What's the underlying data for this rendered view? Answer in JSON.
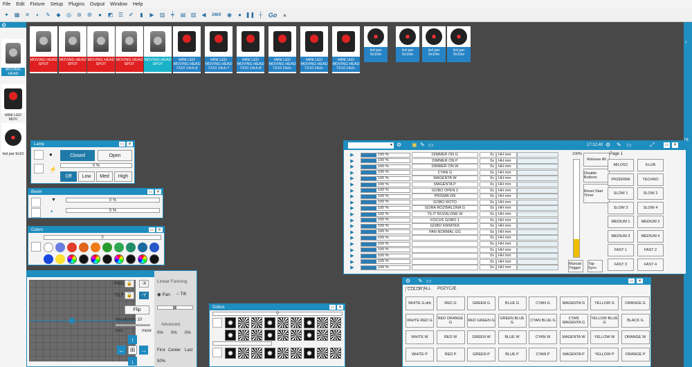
{
  "menu": [
    "File",
    "Edit",
    "Fixture",
    "Setup",
    "Plugins",
    "Output",
    "Window",
    "Help"
  ],
  "toolbar": {
    "dmx": "DMX",
    "go": "Go"
  },
  "left_fixtures": [
    "MOVING HEAD",
    "MINI LED MOV",
    "led par 9x10"
  ],
  "fixtures": [
    {
      "label": "MOVING HEAD SPOT",
      "style": "red",
      "kind": "mh"
    },
    {
      "label": "MOVING HEAD SPOT",
      "style": "red",
      "kind": "mh"
    },
    {
      "label": "MOVING HEAD SPOT",
      "style": "red",
      "kind": "mh"
    },
    {
      "label": "MOVING HEAD SPOT",
      "style": "red",
      "kind": "mh"
    },
    {
      "label": "MOVING HEAD SPOT",
      "style": "teal",
      "kind": "mh"
    },
    {
      "label": "MINI LED MOVING HEAD 7X10 14ch-6",
      "style": "blue",
      "kind": "mini"
    },
    {
      "label": "MINI LED MOVING HEAD 7X10 14ch-7",
      "style": "blue",
      "kind": "mini"
    },
    {
      "label": "MINI LED MOVING HEAD 7X10 14ch-8",
      "style": "blue",
      "kind": "mini"
    },
    {
      "label": "MINI LED MOVING HEAD 7X10 14ch-",
      "style": "blue",
      "kind": "mini"
    },
    {
      "label": "MINI LED MOVING HEAD 7X10 14ch-",
      "style": "blue",
      "kind": "mini"
    },
    {
      "label": "MINI LED MOVING HEAD 7X10 14ch-",
      "style": "blue",
      "kind": "mini"
    },
    {
      "label": "led par 9x10w",
      "style": "blue",
      "kind": "par"
    },
    {
      "label": "led par 9x10w",
      "style": "blue",
      "kind": "par"
    },
    {
      "label": "led par 9x10w",
      "style": "blue",
      "kind": "par"
    },
    {
      "label": "led par 9x10w",
      "style": "blue",
      "kind": "par"
    }
  ],
  "lamp": {
    "title": "Lamp",
    "closed": "Closed",
    "open": "Open",
    "pct": "0 %",
    "off": "Off",
    "low": "Low",
    "med": "Med",
    "high": "High"
  },
  "beam": {
    "title": "Beam",
    "pct1": "0 %",
    "pct2": "0 %"
  },
  "colors": {
    "title": "Colors",
    "value": "0",
    "swatches": [
      "#ffffff",
      "#6a7de0",
      "#e23c2c",
      "#e0641c",
      "#f07a18",
      "#2c9a2c",
      "#2da850",
      "#1f8c6a",
      "#1a6aa0",
      "#2558c8",
      "#1848e0",
      "#ffe030"
    ]
  },
  "pantilt": {
    "pan": "PAN",
    "tilt": "TILT",
    "x": "-X",
    "y": "-Y",
    "flip": "Flip",
    "resolution": "Resolution: 10",
    "less": "less",
    "more": "more",
    "linear": "Linear Fanning",
    "pan_opt": "Pan",
    "tilt_opt": "Tilt",
    "advanced": "Advanced:",
    "p1": "0%",
    "p2": "0%",
    "p3": "0%",
    "first": "First",
    "center": "Center",
    "last": "Last",
    "fifty": "50%"
  },
  "gobos": {
    "title": "Gobos",
    "value": "0"
  },
  "cuelist": {
    "time": "17:12:40",
    "page_num": "16",
    "pct100": "100%",
    "page": "Page 1",
    "rows": [
      {
        "name": "DIMMER ON G",
        "pct": "100 %",
        "t": "0s",
        "fmt": "HH mm"
      },
      {
        "name": "DIMMER ON P",
        "pct": "100 %",
        "t": "0s",
        "fmt": "HH mm"
      },
      {
        "name": "DIMMER ON W",
        "pct": "100 %",
        "t": "0s",
        "fmt": "HH mm"
      },
      {
        "name": "CYAN G",
        "pct": "100 %",
        "t": "0s",
        "fmt": "HH mm"
      },
      {
        "name": "MAGENTA W",
        "pct": "100 %",
        "t": "0s",
        "fmt": "HH mm"
      },
      {
        "name": "MAGENTA P",
        "pct": "100 %",
        "t": "0s",
        "fmt": "HH mm"
      },
      {
        "name": "GOBO OPEN 2",
        "pct": "100 %",
        "t": "0s",
        "fmt": "HH mm"
      },
      {
        "name": "PRISMA ON",
        "pct": "100 %",
        "t": "0s",
        "fmt": "HH mm"
      },
      {
        "name": "GOBO ROTO",
        "pct": "100 %",
        "t": "0s",
        "fmt": "HH mm"
      },
      {
        "name": "GORA ROZWALONA G",
        "pct": "100 %",
        "t": "0s",
        "fmt": "HH mm"
      },
      {
        "name": "TILIT ROZALONE W",
        "pct": "100 %",
        "t": "0s",
        "fmt": "HH mm"
      },
      {
        "name": "FOCUS GOBO 1",
        "pct": "100 %",
        "t": "0s",
        "fmt": "HH mm"
      },
      {
        "name": "GOBO KWIATEK",
        "pct": "100 %",
        "t": "0s",
        "fmt": "HH mm"
      },
      {
        "name": "PAN NORMAL GG",
        "pct": "100 %",
        "t": "0s",
        "fmt": "HH mm"
      },
      {
        "name": "",
        "pct": "100 %",
        "t": "0s",
        "fmt": "HH mm"
      },
      {
        "name": "",
        "pct": "100 %",
        "t": "0s",
        "fmt": "HH mm"
      },
      {
        "name": "",
        "pct": "100 %",
        "t": "0s",
        "fmt": "HH mm"
      },
      {
        "name": "",
        "pct": "100 %",
        "t": "0s",
        "fmt": "HH mm"
      },
      {
        "name": "",
        "pct": "100 %",
        "t": "0s",
        "fmt": "HH mm"
      },
      {
        "name": "",
        "pct": "100 %",
        "t": "0s",
        "fmt": "HH mm"
      }
    ],
    "release": "Release All",
    "disable": "Disable Buttons",
    "reset": "Reset Start Timer",
    "manual": "Manual Trigger",
    "tapsync": "Tap Sync",
    "pages": [
      [
        "MILOSC",
        "KLUB"
      ],
      [
        "PRZERWA",
        "TECHNO"
      ],
      [
        "SLOW 1",
        "SLOW 2"
      ],
      [
        "SLOW 3",
        "SLOW 4"
      ],
      [
        "MEDIUM 1",
        "MEDIUM 2"
      ],
      [
        "MEDIUM 3",
        "MEDIUM 4"
      ],
      [
        "FAST 1",
        "FAST 2"
      ],
      [
        "FAST 3",
        "FAST 4"
      ]
    ]
  },
  "colorpanel": {
    "tabs": [
      "COLOR",
      "ALL",
      "POZYCJE"
    ],
    "rows": [
      [
        "WHITE G.drb",
        "RED G",
        "GREEN G",
        "BLUE G",
        "CYAN G",
        "MAGENTA G",
        "YELLOW G",
        "ORANGE G"
      ],
      [
        "WHITE RED G",
        "RED ORANGE G",
        "RED GREEN G",
        "GREEN BLUE G",
        "CYAN BLUE G",
        "CYAN MAGENTA G",
        "YELLOW BLUE G",
        "BLACK G"
      ],
      [
        "WHITE W",
        "RED W",
        "GREEN W",
        "BLUE W",
        "CYAN W",
        "MAGENTA W",
        "YELLOW W",
        "ORANGE W"
      ],
      [
        "WHITE P",
        "RED P",
        "GREEN P",
        "BLUE P",
        "CYAN P",
        "MAGENTA P",
        "YELLOW P",
        "ORANGE P"
      ]
    ]
  }
}
